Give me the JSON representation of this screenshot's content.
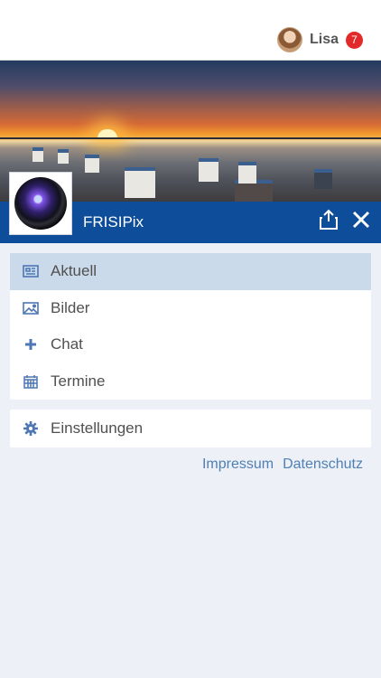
{
  "header": {
    "username": "Lisa",
    "notification_count": "7"
  },
  "app": {
    "name": "FRISIPix"
  },
  "menu": {
    "items": [
      {
        "label": "Aktuell",
        "icon": "newspaper-icon",
        "active": true
      },
      {
        "label": "Bilder",
        "icon": "image-icon",
        "active": false
      },
      {
        "label": "Chat",
        "icon": "plus-icon",
        "active": false
      },
      {
        "label": "Termine",
        "icon": "calendar-icon",
        "active": false
      }
    ],
    "settings_label": "Einstellungen"
  },
  "footer": {
    "impressum": "Impressum",
    "datenschutz": "Datenschutz"
  },
  "colors": {
    "primary": "#0d4d99",
    "active_bg": "#cbdaea",
    "badge": "#e22a2a",
    "link": "#4f7fb4"
  }
}
